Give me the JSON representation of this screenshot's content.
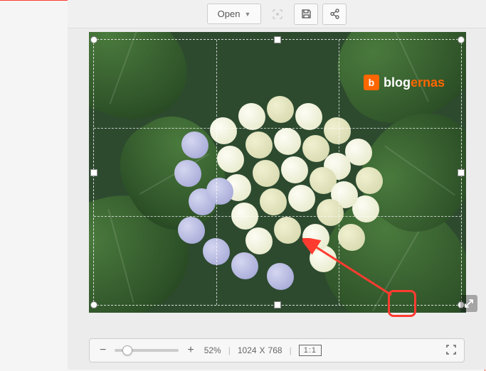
{
  "toolbar": {
    "open_label": "Open",
    "icons": {
      "capture": "capture-icon",
      "save": "save-icon",
      "share": "share-icon"
    }
  },
  "watermark": {
    "logo_letter": "b",
    "text_part1": "blog",
    "text_part2": "ernas"
  },
  "bottombar": {
    "zoom_percent": "52%",
    "width": "1024",
    "sep": "X",
    "height": "768",
    "ratio_label": "1:1"
  },
  "colors": {
    "accent": "#ff6600",
    "annotation": "#ff3b30"
  }
}
